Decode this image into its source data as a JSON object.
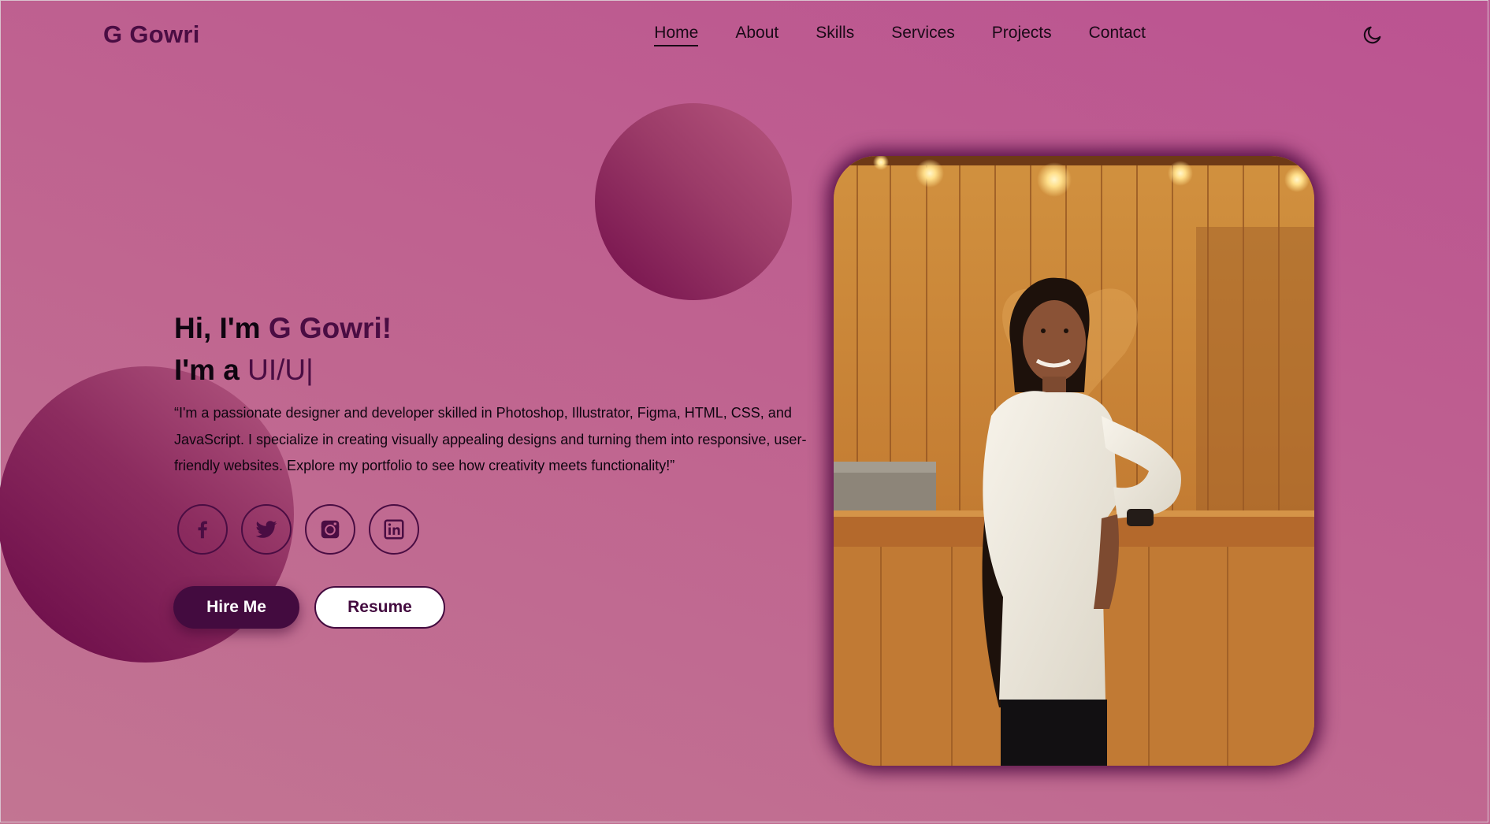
{
  "nav": {
    "logo": "G Gowri",
    "items": [
      {
        "label": "Home",
        "active": true
      },
      {
        "label": "About",
        "active": false
      },
      {
        "label": "Skills",
        "active": false
      },
      {
        "label": "Services",
        "active": false
      },
      {
        "label": "Projects",
        "active": false
      },
      {
        "label": "Contact",
        "active": false
      }
    ],
    "theme_toggle_icon": "moon-icon"
  },
  "hero": {
    "greeting_prefix": "Hi, I'm ",
    "greeting_name": "G Gowri!",
    "role_prefix": "I'm a ",
    "role_typed": "UI/U|",
    "bio": "“I'm a passionate designer and developer skilled in Photoshop, Illustrator, Figma, HTML, CSS, and JavaScript. I specialize in creating visually appealing designs and turning them into responsive, user-friendly websites. Explore my portfolio to see how creativity meets functionality!”",
    "socials": [
      {
        "icon": "facebook-icon"
      },
      {
        "icon": "twitter-icon"
      },
      {
        "icon": "instagram-icon"
      },
      {
        "icon": "linkedin-icon"
      }
    ],
    "hire_label": "Hire Me",
    "resume_label": "Resume"
  },
  "colors": {
    "accent": "#4a0d43",
    "background": "#bf6290",
    "button_dark": "#430b3f"
  }
}
